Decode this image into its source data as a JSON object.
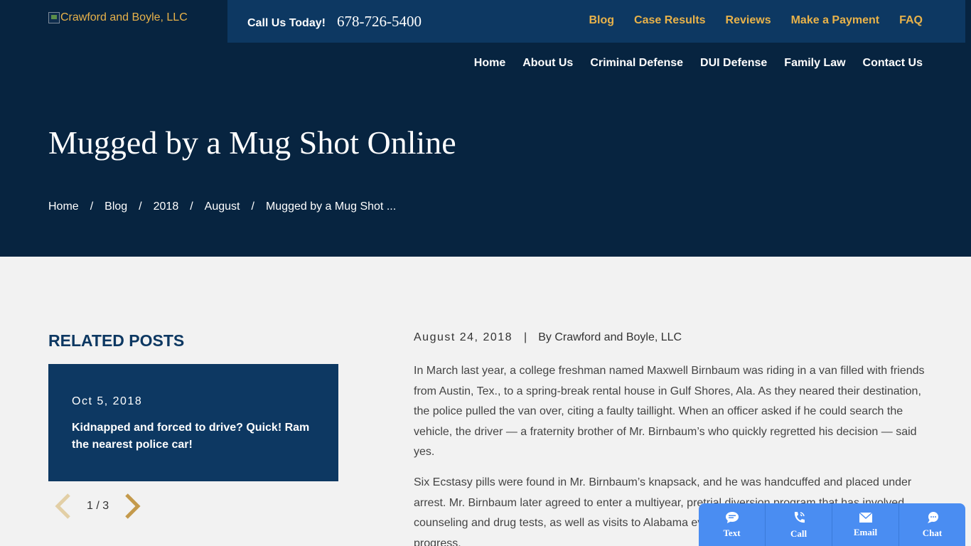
{
  "header": {
    "logo_alt": "Crawford and Boyle, LLC",
    "call_label": "Call Us Today!",
    "phone": "678-726-5400",
    "utility_nav": [
      "Blog",
      "Case Results",
      "Reviews",
      "Make a Payment",
      "FAQ"
    ],
    "main_nav": [
      "Home",
      "About Us",
      "Criminal Defense",
      "DUI Defense",
      "Family Law",
      "Contact Us"
    ]
  },
  "hero": {
    "title": "Mugged by a Mug Shot Online",
    "breadcrumb": [
      "Home",
      "Blog",
      "2018",
      "August",
      "Mugged by a Mug Shot ..."
    ],
    "separator": "/"
  },
  "sidebar": {
    "title": "RELATED POSTS",
    "post": {
      "date": "Oct 5, 2018",
      "title": "Kidnapped and forced to drive? Quick! Ram the nearest police car!"
    },
    "pager": "1 / 3"
  },
  "article": {
    "date": "August 24, 2018",
    "pipe": "|",
    "author": "By Crawford and Boyle, LLC",
    "paragraphs": [
      "In March last year, a college freshman named Maxwell Birnbaum was riding in a van filled with friends from Austin, Tex., to a spring-break rental house in Gulf Shores, Ala. As they neared their destination, the police pulled the van over, citing a faulty taillight. When an officer asked if he could search the vehicle, the driver — a fraternity brother of Mr. Birnbaum’s who quickly regretted his decision — said yes.",
      "Six Ecstasy pills were found in Mr. Birnbaum’s knapsack, and he was handcuffed and placed under arrest. Mr. Birnbaum later agreed to enter a multiyear, pretrial diversion program that has involved counseling and drug tests, as well as visits to Alabama every few months to update a judge on his progress."
    ]
  },
  "widget": {
    "buttons": [
      "Text",
      "Call",
      "Email",
      "Chat"
    ]
  },
  "colors": {
    "hero_bg": "#072440",
    "topbar_bg": "#0d3862",
    "gold": "#e8b24a",
    "widget_bg": "#4a8df2"
  }
}
